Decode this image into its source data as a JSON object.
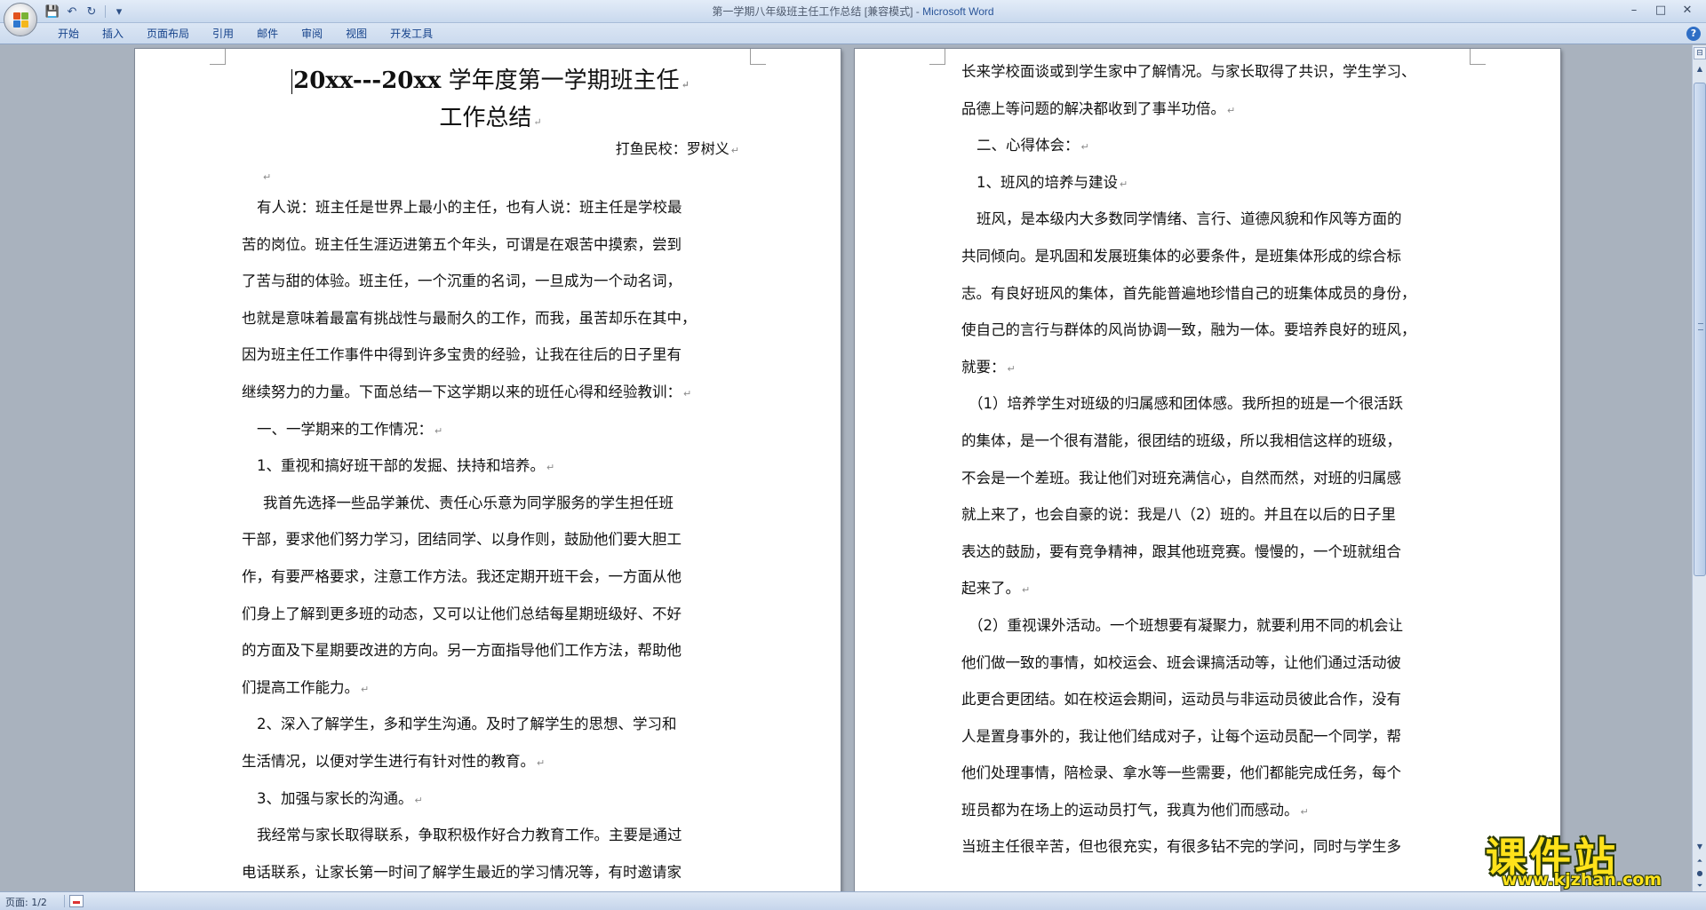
{
  "window": {
    "title_doc": "第一学期八年级班主任工作总结 [兼容模式]",
    "title_sep": " - ",
    "title_app": "Microsoft Word"
  },
  "quick_access": {
    "save_icon": "💾",
    "undo_icon": "↶",
    "redo_icon": "↻",
    "customize_icon": "▾"
  },
  "window_controls": {
    "minimize": "–",
    "maximize": "□",
    "close": "✕"
  },
  "ribbon": {
    "tabs": [
      "开始",
      "插入",
      "页面布局",
      "引用",
      "邮件",
      "审阅",
      "视图",
      "开发工具"
    ],
    "help": "?"
  },
  "document": {
    "page1": {
      "title_line1_latin": "20xx---20xx",
      "title_line1_cn": " 学年度第一学期班主任",
      "title_line2": "工作总结",
      "author": "打鱼民校：罗树义",
      "lines": [
        "有人说：班主任是世界上最小的主任，也有人说：班主任是学校最",
        "苦的岗位。班主任生涯迈进第五个年头，可谓是在艰苦中摸索，尝到",
        "了苦与甜的体验。班主任，一个沉重的名词，一旦成为一个动名词，",
        "也就是意味着最富有挑战性与最耐久的工作，而我，虽苦却乐在其中，",
        "因为班主任工作事件中得到许多宝贵的经验，让我在往后的日子里有",
        "继续努力的力量。下面总结一下这学期以来的班任心得和经验教训：",
        "一、一学期来的工作情况：",
        "1、重视和搞好班干部的发掘、扶持和培养。",
        "我首先选择一些品学兼优、责任心乐意为同学服务的学生担任班",
        "干部，要求他们努力学习，团结同学、以身作则，鼓励他们要大胆工",
        "作，有要严格要求，注意工作方法。我还定期开班干会，一方面从他",
        "们身上了解到更多班的动态，又可以让他们总结每星期班级好、不好",
        "的方面及下星期要改进的方向。另一方面指导他们工作方法，帮助他",
        "们提高工作能力。",
        "2、深入了解学生，多和学生沟通。及时了解学生的思想、学习和",
        "生活情况，以便对学生进行有针对性的教育。",
        "3、加强与家长的沟通。",
        "我经常与家长取得联系，争取积极作好合力教育工作。主要是通过",
        "电话联系，让家长第一时间了解学生最近的学习情况等，有时邀请家"
      ]
    },
    "page2": {
      "lines": [
        "长来学校面谈或到学生家中了解情况。与家长取得了共识，学生学习、",
        "品德上等问题的解决都收到了事半功倍。",
        "二、心得体会：",
        "1、班风的培养与建设",
        "班风，是本级内大多数同学情绪、言行、道德风貌和作风等方面的",
        "共同倾向。是巩固和发展班集体的必要条件，是班集体形成的综合标",
        "志。有良好班风的集体，首先能普遍地珍惜自己的班集体成员的身份，",
        "使自己的言行与群体的风尚协调一致，融为一体。要培养良好的班风，",
        "就要：",
        "（1）培养学生对班级的归属感和团体感。我所担的班是一个很活跃",
        "的集体，是一个很有潜能，很团结的班级，所以我相信这样的班级，",
        "不会是一个差班。我让他们对班充满信心，自然而然，对班的归属感",
        "就上来了，也会自豪的说：我是八（2）班的。并且在以后的日子里",
        "表达的鼓励，要有竞争精神，跟其他班竞赛。慢慢的，一个班就组合",
        "起来了。",
        "（2）重视课外活动。一个班想要有凝聚力，就要利用不同的机会让",
        "他们做一致的事情，如校运会、班会课搞活动等，让他们通过活动彼",
        "此更合更团结。如在校运会期间，运动员与非运动员彼此合作，没有",
        "人是置身事外的，我让他们结成对子，让每个运动员配一个同学，帮",
        "他们处理事情，陪检录、拿水等一些需要，他们都能完成任务，每个",
        "班员都为在场上的运动员打气，我真为他们而感动。",
        "当班主任很辛苦，但也很充实，有很多钻不完的学问，同时与学生多"
      ]
    },
    "paragraph_mark": "↵"
  },
  "statusbar": {
    "page": "页面: 1/2"
  },
  "watermark": {
    "big": "课件站",
    "small": "www.kjzhan.com"
  }
}
